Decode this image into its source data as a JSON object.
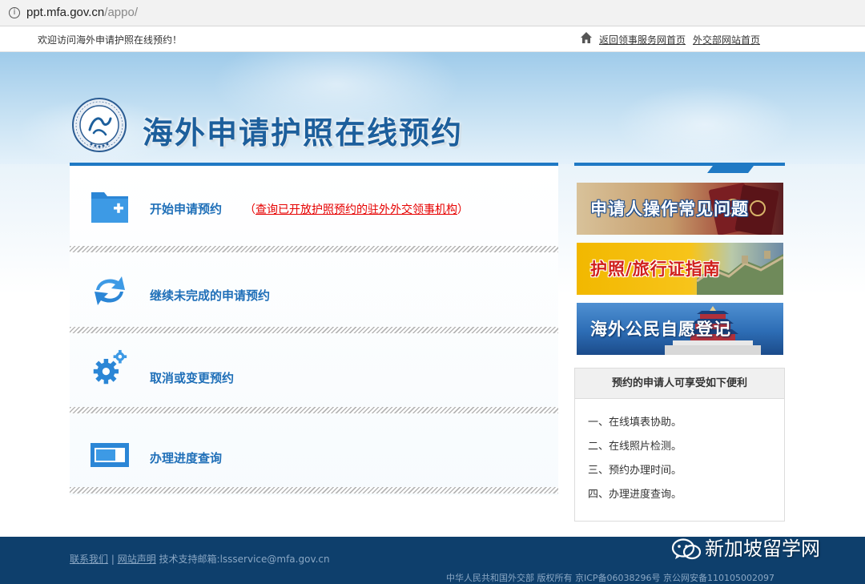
{
  "browser": {
    "url_host": "ppt.mfa.gov.cn",
    "url_path": "/appo/"
  },
  "topbar": {
    "welcome": "欢迎访问海外申请护照在线预约！",
    "links": [
      "返回领事服务网首页",
      "外交部网站首页"
    ]
  },
  "header": {
    "title": "海外申请护照在线预约",
    "emblem_text": "CHINA CONSULAR AFFAIRS"
  },
  "menu": {
    "items": [
      {
        "label": "开始申请预约",
        "icon": "folder-add-icon",
        "note": "查询已开放护照预约的驻外外交领事机构"
      },
      {
        "label": "继续未完成的申请预约",
        "icon": "refresh-icon"
      },
      {
        "label": "取消或变更预约",
        "icon": "gear-icon"
      },
      {
        "label": "办理进度查询",
        "icon": "progress-icon"
      }
    ]
  },
  "sidebar": {
    "banners": [
      "申请人操作常见问题",
      "护照/旅行证指南",
      "海外公民自愿登记"
    ],
    "benefits_title": "预约的申请人可享受如下便利",
    "benefits": [
      "一、在线填表协助。",
      "二、在线照片检测。",
      "三、预约办理时间。",
      "四、办理进度查询。"
    ]
  },
  "footer": {
    "contact": "联系我们",
    "statement": "网站声明",
    "support": "技术支持邮箱:lssservice@mfa.gov.cn",
    "copyright": "中华人民共和国外交部 版权所有 京ICP备06038296号 京公网安备110105002097"
  },
  "watermark": "新加坡留学网",
  "colors": {
    "accent": "#1f79c4",
    "link_blue": "#1f6fb8",
    "alert_red": "#e60000",
    "footer_bg": "#0e3f6c"
  }
}
